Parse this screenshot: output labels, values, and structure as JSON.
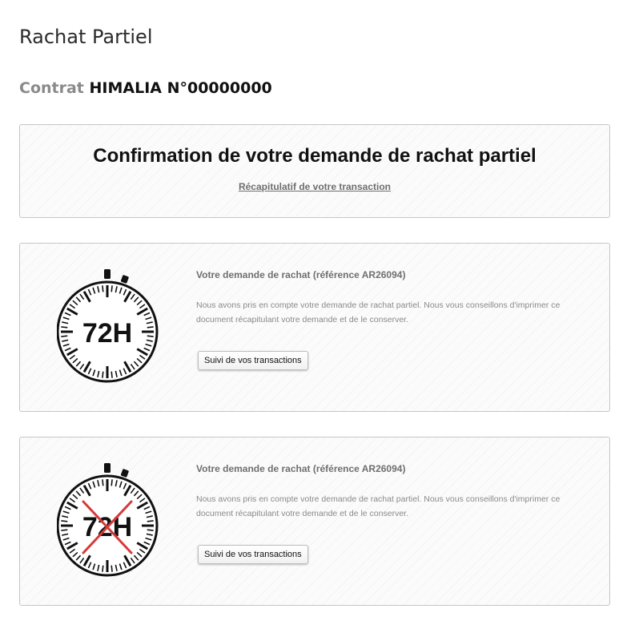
{
  "page": {
    "title": "Rachat Partiel",
    "contract_prefix": "Contrat",
    "contract_value": "HIMALIA N°00000000"
  },
  "confirmation": {
    "title": "Confirmation de votre demande de rachat partiel",
    "summary_link": "Récapitulatif de votre transaction"
  },
  "requests": [
    {
      "title": "Votre demande de rachat (référence AR26094)",
      "description": "Nous avons pris en compte votre demande de rachat partiel. Nous vous conseillons d'imprimer ce document récapitulant votre demande et de le conserver.",
      "badge_text": "72H",
      "badge_icon": "stopwatch-72h-icon",
      "button_label": "Suivi de vos transactions"
    },
    {
      "title": "Votre demande de rachat (référence AR26094)",
      "description": "Nous avons pris en compte votre demande de rachat partiel. Nous vous conseillons d'imprimer ce document récapitulant votre demande et de le conserver.",
      "badge_text": "72H",
      "badge_icon": "stopwatch-72h-crossed-icon",
      "cross_color": "#d63a3a",
      "button_label": "Suivi de vos transactions"
    }
  ]
}
